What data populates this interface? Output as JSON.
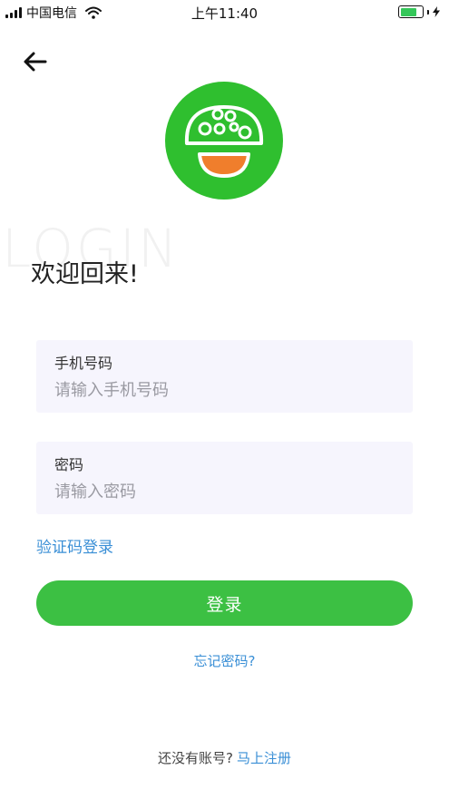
{
  "status_bar": {
    "carrier": "中国电信",
    "time": "上午11:40",
    "battery_level": 0.75
  },
  "colors": {
    "brand_green": "#3cc043",
    "logo_green": "#2fbf2f",
    "logo_orange": "#f07e2c",
    "link_blue": "#3a8fd6",
    "field_bg": "#f6f5fd"
  },
  "icons": {
    "back": "arrow-left-icon",
    "logo": "mushroom-logo"
  },
  "header": {
    "watermark": "LOGIN",
    "welcome": "欢迎回来!"
  },
  "form": {
    "phone_label": "手机号码",
    "phone_placeholder": "请输入手机号码",
    "password_label": "密码",
    "password_placeholder": "请输入密码",
    "code_login": "验证码登录",
    "submit": "登录",
    "forgot": "忘记密码?"
  },
  "footer": {
    "no_account": "还没有账号?",
    "register": "马上注册"
  }
}
